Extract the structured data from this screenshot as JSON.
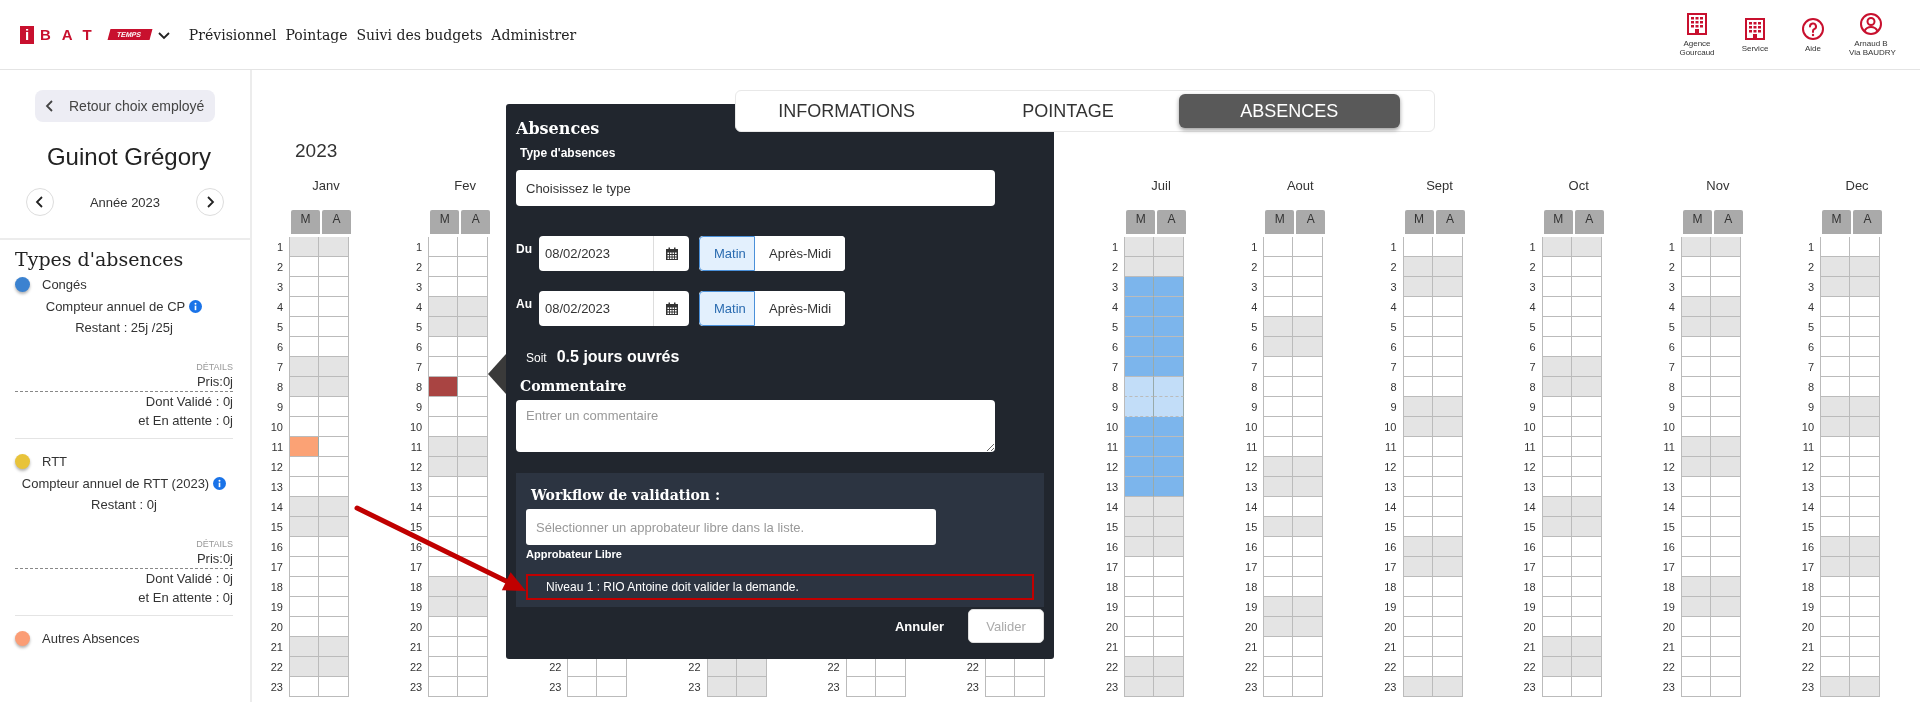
{
  "header": {
    "logo": {
      "mark": "i",
      "name": "BAT",
      "tag": "TEMPS"
    },
    "nav": [
      "Prévisionnel",
      "Pointage",
      "Suivi des budgets",
      "Administrer"
    ],
    "tools": [
      {
        "kind": "building",
        "label": "Agence Gourcaud"
      },
      {
        "kind": "building",
        "label": "Service"
      },
      {
        "kind": "help",
        "label": "Aide"
      },
      {
        "kind": "user",
        "label": "Arnaud B",
        "sublabel": "Via BAUDRY"
      }
    ]
  },
  "employee_panel": {
    "back_button": "Retour choix employé",
    "name": "Guinot Grégory",
    "year": "Année 2023",
    "types_title": "Types d'absences",
    "absence_types": [
      {
        "name": "Congés",
        "color": "#3b82d0",
        "counter": "Compteur annuel de CP",
        "remaining": "Restant : 25j /25j",
        "details_label": "DÉTAILS",
        "taken": "Pris:0j",
        "validated": "Dont Validé : 0j",
        "pending": "et En attente : 0j"
      },
      {
        "name": "RTT",
        "color": "#e8c33a",
        "counter": "Compteur annuel de RTT (2023)",
        "remaining": "Restant : 0j",
        "details_label": "DÉTAILS",
        "taken": "Pris:0j",
        "validated": "Dont Validé : 0j",
        "pending": "et En attente : 0j"
      },
      {
        "name": "Autres Absences",
        "color": "#fb9d75"
      }
    ]
  },
  "tabs": [
    {
      "label": "INFORMATIONS",
      "selected": false
    },
    {
      "label": "POINTAGE",
      "selected": false
    },
    {
      "label": "ABSENCES",
      "selected": true
    }
  ],
  "calendar": {
    "year": "2023",
    "months": [
      {
        "name": "Janv",
        "halves": [
          "M",
          "A"
        ],
        "days": [
          {
            "day": "1",
            "off": true
          },
          {
            "day": "2",
            "off": false
          },
          {
            "day": "3",
            "off": false
          },
          {
            "day": "4",
            "off": false
          },
          {
            "day": "5",
            "off": false
          },
          {
            "day": "6",
            "off": false
          },
          {
            "day": "7",
            "off": true
          },
          {
            "day": "8",
            "off": true
          },
          {
            "day": "9",
            "off": false
          },
          {
            "day": "10",
            "off": false
          },
          {
            "day": "11",
            "off": false,
            "absence": {
              "morning": true,
              "afternoon": false,
              "color": "#fba275"
            }
          },
          {
            "day": "12",
            "off": false
          },
          {
            "day": "13",
            "off": false
          },
          {
            "day": "14",
            "off": true
          },
          {
            "day": "15",
            "off": true
          },
          {
            "day": "16",
            "off": false
          },
          {
            "day": "17",
            "off": false
          },
          {
            "day": "18",
            "off": false
          },
          {
            "day": "19",
            "off": false
          },
          {
            "day": "20",
            "off": false
          },
          {
            "day": "21",
            "off": true
          },
          {
            "day": "22",
            "off": true
          },
          {
            "day": "23",
            "off": false
          }
        ]
      },
      {
        "name": "Fev",
        "halves": [
          "M",
          "A"
        ],
        "days": [
          {
            "day": "1",
            "off": false
          },
          {
            "day": "2",
            "off": false
          },
          {
            "day": "3",
            "off": false
          },
          {
            "day": "4",
            "off": true
          },
          {
            "day": "5",
            "off": true
          },
          {
            "day": "6",
            "off": false
          },
          {
            "day": "7",
            "off": false
          },
          {
            "day": "8",
            "off": false,
            "absence": {
              "morning": true,
              "afternoon": false,
              "color": "#a94442"
            }
          },
          {
            "day": "9",
            "off": false
          },
          {
            "day": "10",
            "off": false
          },
          {
            "day": "11",
            "off": true
          },
          {
            "day": "12",
            "off": true
          },
          {
            "day": "13",
            "off": false
          },
          {
            "day": "14",
            "off": false
          },
          {
            "day": "15",
            "off": false
          },
          {
            "day": "16",
            "off": false
          },
          {
            "day": "17",
            "off": false
          },
          {
            "day": "18",
            "off": true
          },
          {
            "day": "19",
            "off": true
          },
          {
            "day": "20",
            "off": false
          },
          {
            "day": "21",
            "off": false
          },
          {
            "day": "22",
            "off": false
          },
          {
            "day": "23",
            "off": false
          }
        ]
      },
      {
        "days": [
          {
            "day": "22",
            "off": false
          },
          {
            "day": "23",
            "off": false
          }
        ]
      },
      {
        "days": [
          {
            "day": "22",
            "off": true
          },
          {
            "day": "23",
            "off": true
          }
        ]
      },
      {
        "days": [
          {
            "day": "22",
            "off": false
          },
          {
            "day": "23",
            "off": false
          }
        ]
      },
      {
        "days": [
          {
            "day": "22",
            "off": false
          },
          {
            "day": "23",
            "off": false
          }
        ]
      },
      {
        "name": "Juil",
        "halves": [
          "M",
          "A"
        ],
        "days": [
          {
            "day": "1",
            "off": true
          },
          {
            "day": "2",
            "off": true
          },
          {
            "day": "3",
            "off": false,
            "absence": {
              "morning": true,
              "afternoon": true,
              "color": "#7cb5ec"
            }
          },
          {
            "day": "4",
            "off": false,
            "absence": {
              "morning": true,
              "afternoon": true,
              "color": "#7cb5ec"
            }
          },
          {
            "day": "5",
            "off": false,
            "absence": {
              "morning": true,
              "afternoon": true,
              "color": "#7cb5ec"
            }
          },
          {
            "day": "6",
            "off": false,
            "absence": {
              "morning": true,
              "afternoon": true,
              "color": "#7cb5ec"
            }
          },
          {
            "day": "7",
            "off": false,
            "absence": {
              "morning": true,
              "afternoon": true,
              "color": "#7cb5ec"
            }
          },
          {
            "day": "8",
            "off": true,
            "absence": {
              "morning": true,
              "afternoon": true,
              "color": "#c2ddf8"
            }
          },
          {
            "day": "9",
            "off": true,
            "absence": {
              "morning": true,
              "afternoon": true,
              "color": "#c2ddf8"
            }
          },
          {
            "day": "10",
            "off": false,
            "absence": {
              "morning": true,
              "afternoon": true,
              "color": "#7cb5ec"
            }
          },
          {
            "day": "11",
            "off": false,
            "absence": {
              "morning": true,
              "afternoon": true,
              "color": "#7cb5ec"
            }
          },
          {
            "day": "12",
            "off": false,
            "absence": {
              "morning": true,
              "afternoon": true,
              "color": "#7cb5ec"
            }
          },
          {
            "day": "13",
            "off": false,
            "absence": {
              "morning": true,
              "afternoon": true,
              "color": "#7cb5ec"
            }
          },
          {
            "day": "14",
            "off": true
          },
          {
            "day": "15",
            "off": true
          },
          {
            "day": "16",
            "off": true
          },
          {
            "day": "17",
            "off": false
          },
          {
            "day": "18",
            "off": false
          },
          {
            "day": "19",
            "off": false
          },
          {
            "day": "20",
            "off": false
          },
          {
            "day": "21",
            "off": false
          },
          {
            "day": "22",
            "off": true
          },
          {
            "day": "23",
            "off": true
          }
        ]
      },
      {
        "name": "Aout",
        "halves": [
          "M",
          "A"
        ],
        "days": [
          {
            "day": "1",
            "off": false
          },
          {
            "day": "2",
            "off": false
          },
          {
            "day": "3",
            "off": false
          },
          {
            "day": "4",
            "off": false
          },
          {
            "day": "5",
            "off": true
          },
          {
            "day": "6",
            "off": true
          },
          {
            "day": "7",
            "off": false
          },
          {
            "day": "8",
            "off": false
          },
          {
            "day": "9",
            "off": false
          },
          {
            "day": "10",
            "off": false
          },
          {
            "day": "11",
            "off": false
          },
          {
            "day": "12",
            "off": true
          },
          {
            "day": "13",
            "off": true
          },
          {
            "day": "14",
            "off": false
          },
          {
            "day": "15",
            "off": true
          },
          {
            "day": "16",
            "off": false
          },
          {
            "day": "17",
            "off": false
          },
          {
            "day": "18",
            "off": false
          },
          {
            "day": "19",
            "off": true
          },
          {
            "day": "20",
            "off": true
          },
          {
            "day": "21",
            "off": false
          },
          {
            "day": "22",
            "off": false
          },
          {
            "day": "23",
            "off": false
          }
        ]
      },
      {
        "name": "Sept",
        "halves": [
          "M",
          "A"
        ],
        "days": [
          {
            "day": "1",
            "off": false
          },
          {
            "day": "2",
            "off": true
          },
          {
            "day": "3",
            "off": true
          },
          {
            "day": "4",
            "off": false
          },
          {
            "day": "5",
            "off": false
          },
          {
            "day": "6",
            "off": false
          },
          {
            "day": "7",
            "off": false
          },
          {
            "day": "8",
            "off": false
          },
          {
            "day": "9",
            "off": true
          },
          {
            "day": "10",
            "off": true
          },
          {
            "day": "11",
            "off": false
          },
          {
            "day": "12",
            "off": false
          },
          {
            "day": "13",
            "off": false
          },
          {
            "day": "14",
            "off": false
          },
          {
            "day": "15",
            "off": false
          },
          {
            "day": "16",
            "off": true
          },
          {
            "day": "17",
            "off": true
          },
          {
            "day": "18",
            "off": false
          },
          {
            "day": "19",
            "off": false
          },
          {
            "day": "20",
            "off": false
          },
          {
            "day": "21",
            "off": false
          },
          {
            "day": "22",
            "off": false
          },
          {
            "day": "23",
            "off": true
          }
        ]
      },
      {
        "name": "Oct",
        "halves": [
          "M",
          "A"
        ],
        "days": [
          {
            "day": "1",
            "off": true
          },
          {
            "day": "2",
            "off": false
          },
          {
            "day": "3",
            "off": false
          },
          {
            "day": "4",
            "off": false
          },
          {
            "day": "5",
            "off": false
          },
          {
            "day": "6",
            "off": false
          },
          {
            "day": "7",
            "off": true
          },
          {
            "day": "8",
            "off": true
          },
          {
            "day": "9",
            "off": false
          },
          {
            "day": "10",
            "off": false
          },
          {
            "day": "11",
            "off": false
          },
          {
            "day": "12",
            "off": false
          },
          {
            "day": "13",
            "off": false
          },
          {
            "day": "14",
            "off": true
          },
          {
            "day": "15",
            "off": true
          },
          {
            "day": "16",
            "off": false
          },
          {
            "day": "17",
            "off": false
          },
          {
            "day": "18",
            "off": false
          },
          {
            "day": "19",
            "off": false
          },
          {
            "day": "20",
            "off": false
          },
          {
            "day": "21",
            "off": true
          },
          {
            "day": "22",
            "off": true
          },
          {
            "day": "23",
            "off": false
          }
        ]
      },
      {
        "name": "Nov",
        "halves": [
          "M",
          "A"
        ],
        "days": [
          {
            "day": "1",
            "off": true
          },
          {
            "day": "2",
            "off": false
          },
          {
            "day": "3",
            "off": false
          },
          {
            "day": "4",
            "off": true
          },
          {
            "day": "5",
            "off": true
          },
          {
            "day": "6",
            "off": false
          },
          {
            "day": "7",
            "off": false
          },
          {
            "day": "8",
            "off": false
          },
          {
            "day": "9",
            "off": false
          },
          {
            "day": "10",
            "off": false
          },
          {
            "day": "11",
            "off": true
          },
          {
            "day": "12",
            "off": true
          },
          {
            "day": "13",
            "off": false
          },
          {
            "day": "14",
            "off": false
          },
          {
            "day": "15",
            "off": false
          },
          {
            "day": "16",
            "off": false
          },
          {
            "day": "17",
            "off": false
          },
          {
            "day": "18",
            "off": true
          },
          {
            "day": "19",
            "off": true
          },
          {
            "day": "20",
            "off": false
          },
          {
            "day": "21",
            "off": false
          },
          {
            "day": "22",
            "off": false
          },
          {
            "day": "23",
            "off": false
          }
        ]
      },
      {
        "name": "Dec",
        "halves": [
          "M",
          "A"
        ],
        "days": [
          {
            "day": "1",
            "off": false
          },
          {
            "day": "2",
            "off": true
          },
          {
            "day": "3",
            "off": true
          },
          {
            "day": "4",
            "off": false
          },
          {
            "day": "5",
            "off": false
          },
          {
            "day": "6",
            "off": false
          },
          {
            "day": "7",
            "off": false
          },
          {
            "day": "8",
            "off": false
          },
          {
            "day": "9",
            "off": true
          },
          {
            "day": "10",
            "off": true
          },
          {
            "day": "11",
            "off": false
          },
          {
            "day": "12",
            "off": false
          },
          {
            "day": "13",
            "off": false
          },
          {
            "day": "14",
            "off": false
          },
          {
            "day": "15",
            "off": false
          },
          {
            "day": "16",
            "off": true
          },
          {
            "day": "17",
            "off": true
          },
          {
            "day": "18",
            "off": false
          },
          {
            "day": "19",
            "off": false
          },
          {
            "day": "20",
            "off": false
          },
          {
            "day": "21",
            "off": false
          },
          {
            "day": "22",
            "off": false
          },
          {
            "day": "23",
            "off": true
          }
        ]
      }
    ]
  },
  "absence_dialog": {
    "title": "Absences",
    "type_label": "Type d'absences",
    "type_select": {
      "value": "Choisissez le type"
    },
    "periods": [
      {
        "label": "Du",
        "date": "08/02/2023",
        "options": [
          {
            "label": "Matin",
            "selected": true
          },
          {
            "label": "Après-Midi",
            "selected": false
          }
        ]
      },
      {
        "label": "Au",
        "date": "08/02/2023",
        "options": [
          {
            "label": "Matin",
            "selected": true
          },
          {
            "label": "Après-Midi",
            "selected": false
          }
        ]
      }
    ],
    "total_prefix": "Soit",
    "total": "0.5 jours ouvrés",
    "comment_label": "Commentaire",
    "comment": {
      "placeholder": "Entrer un commentaire"
    },
    "workflow": {
      "title": "Workflow de validation :",
      "approver": {
        "placeholder": "Sélectionner un approbateur libre dans la liste."
      },
      "approver_label": "Approbateur Libre",
      "levels": [
        {
          "text": "Niveau 1 : RIO Antoine doit valider la demande.",
          "highlighted": true
        }
      ]
    },
    "actions": [
      {
        "label": "Annuler",
        "kind": "text"
      },
      {
        "label": "Valider",
        "kind": "primary",
        "disabled": true
      }
    ]
  }
}
